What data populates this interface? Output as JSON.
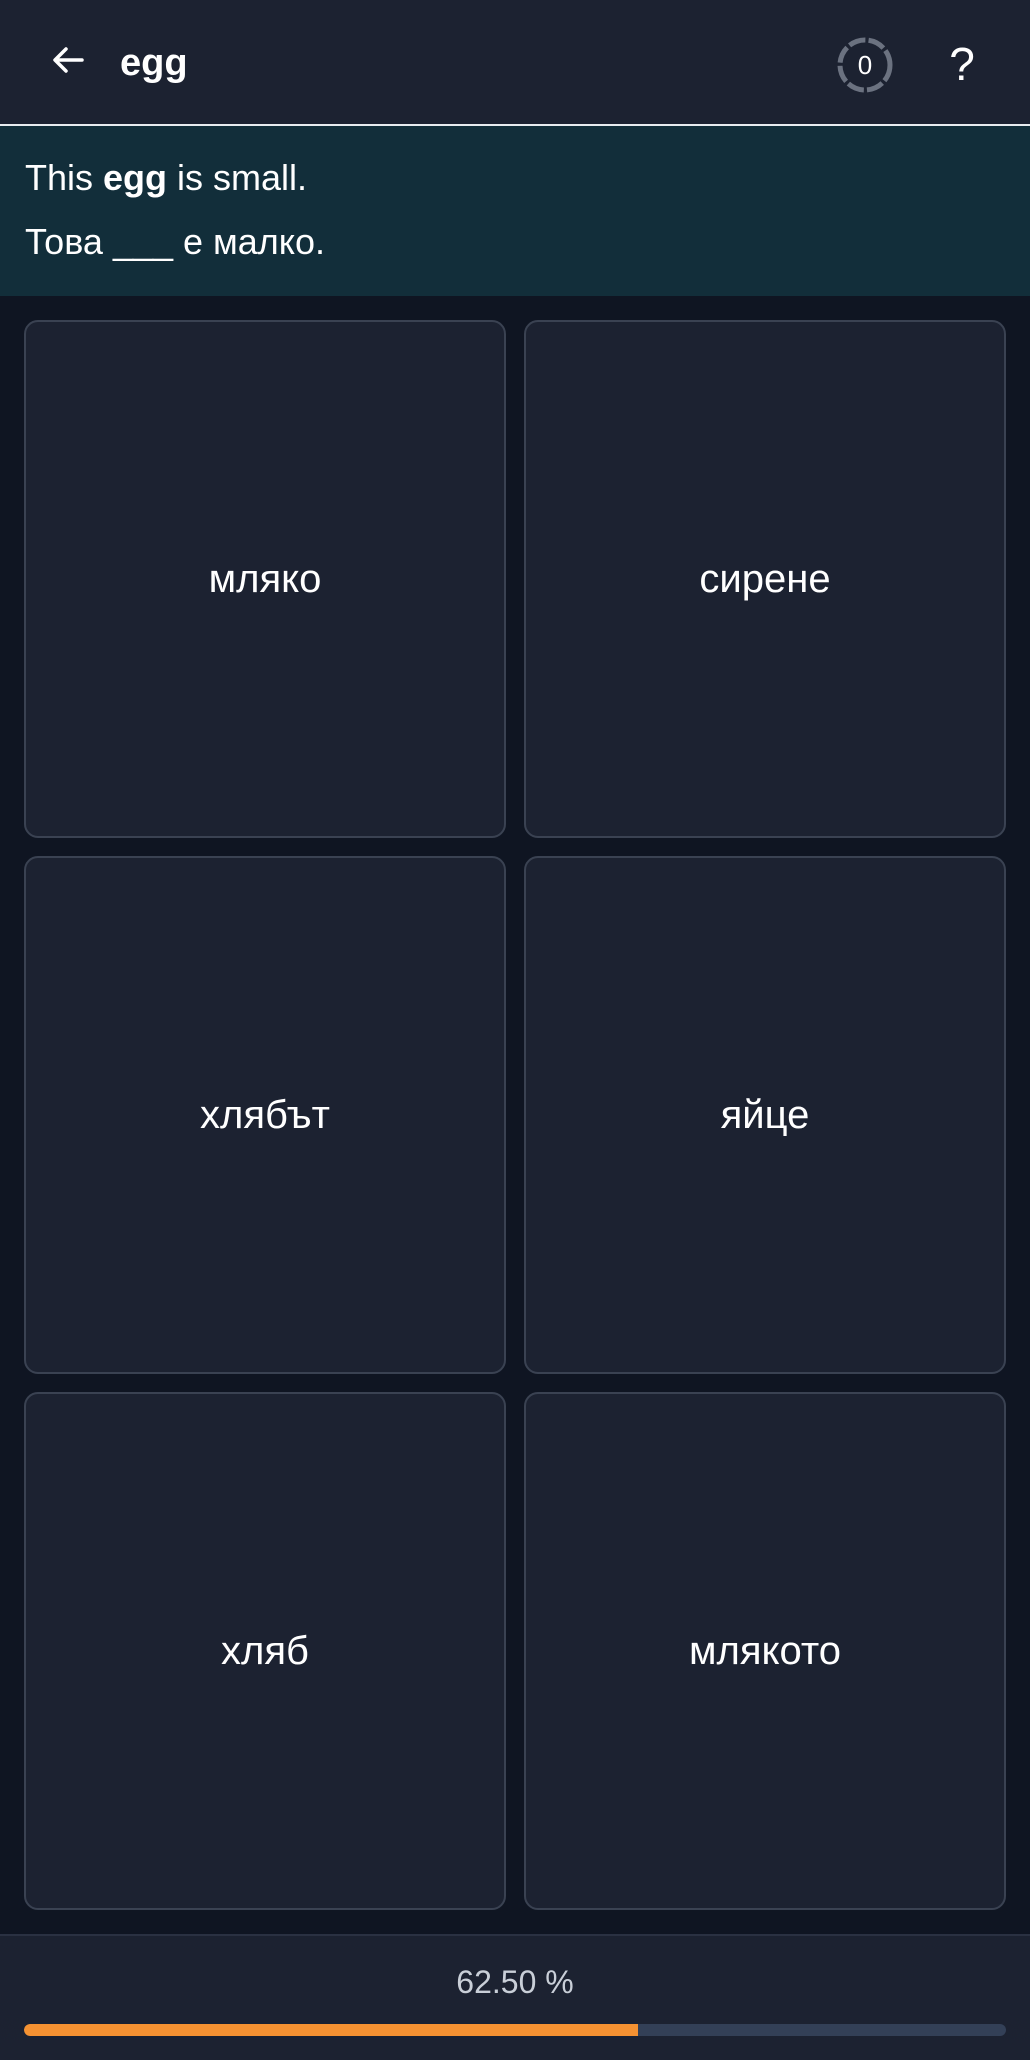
{
  "header": {
    "title": "egg",
    "back_icon": "arrow-left-icon",
    "counter_value": "0",
    "help_label": "?"
  },
  "prompt": {
    "english_prefix": "This ",
    "english_word": "egg",
    "english_suffix": " is small.",
    "target_sentence": "Това ___ е малко."
  },
  "options": [
    {
      "label": "мляко"
    },
    {
      "label": "сирене"
    },
    {
      "label": "хлябът"
    },
    {
      "label": "яйце"
    },
    {
      "label": "хляб"
    },
    {
      "label": "млякото"
    }
  ],
  "progress": {
    "text": "62.50 %",
    "fraction": 0.625,
    "fill_color": "#f59232",
    "track_color": "#334057"
  }
}
